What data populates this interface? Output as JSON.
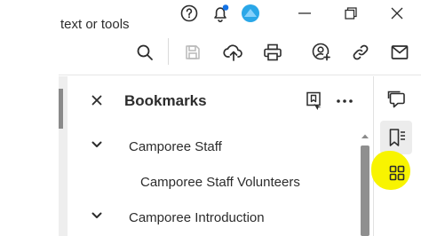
{
  "toolbar": {
    "search_text": "text or tools"
  },
  "bookmarks": {
    "title": "Bookmarks",
    "items": [
      {
        "label": "Camporee Staff"
      },
      {
        "label": "Camporee Staff Volunteers"
      },
      {
        "label": "Camporee Introduction"
      }
    ]
  },
  "icons": {
    "titlebar": [
      "help-icon",
      "notification-bell-icon",
      "profile-avatar-icon",
      "minimize-icon",
      "restore-icon",
      "close-window-icon"
    ],
    "toolbar": [
      "search-icon",
      "save-icon",
      "upload-cloud-icon",
      "print-icon",
      "share-user-icon",
      "link-icon",
      "mail-icon"
    ],
    "rail": [
      "comment-icon",
      "bookmarks-icon",
      "grid-apps-icon"
    ]
  },
  "colors": {
    "highlight": "#f8f400",
    "notification_dot": "#1473e6",
    "avatar": "#2aa7e8"
  }
}
